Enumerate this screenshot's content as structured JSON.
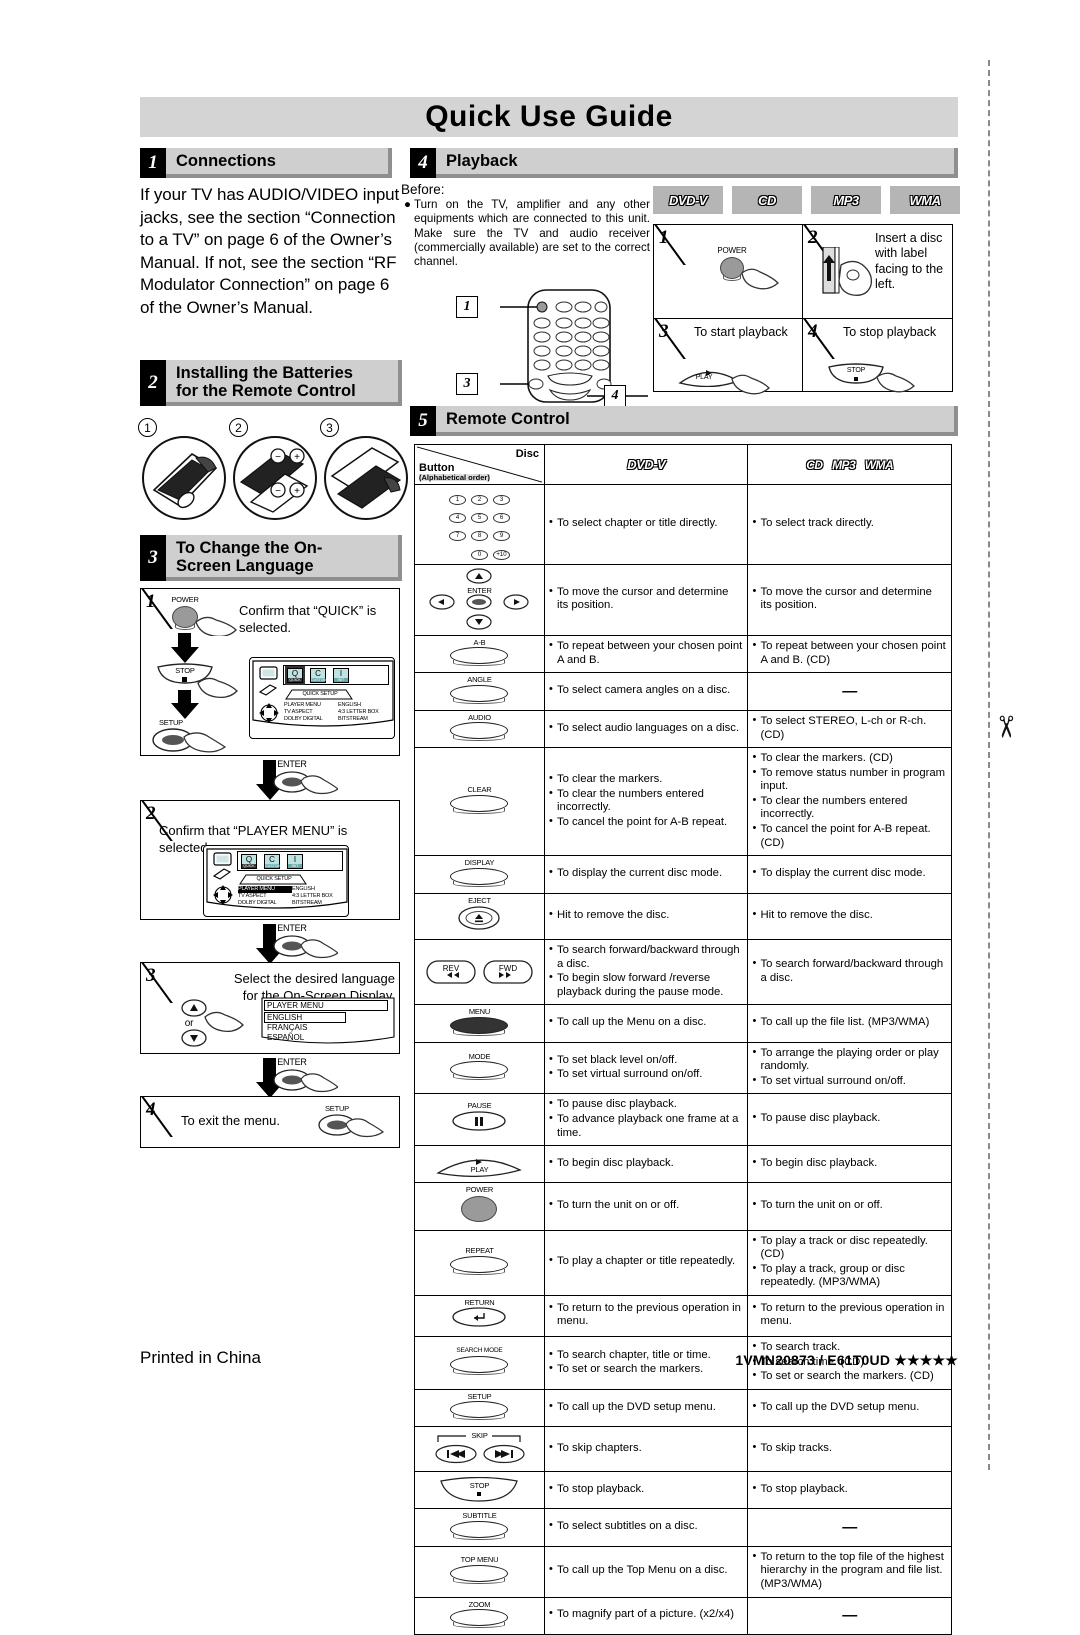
{
  "document": {
    "title": "Quick Use Guide",
    "footer_left": "Printed in China",
    "footer_right": "1VMN20873 / E61T0UD ★★★★★"
  },
  "sections": {
    "connections": {
      "number": "1",
      "title": "Connections",
      "body": "If your TV has AUDIO/VIDEO input jacks, see the section “Connection to a TV” on page 6 of the Owner’s Manual. If not, see the section “RF Modulator Connection” on page 6 of the Owner’s Manual."
    },
    "batteries": {
      "number": "2",
      "title_line1": "Installing the Batteries",
      "title_line2": "for the Remote Control",
      "figures": [
        "1",
        "2",
        "3"
      ],
      "polarity": [
        "−",
        "+",
        "−",
        "+"
      ]
    },
    "language": {
      "number": "3",
      "title_line1": "To Change the On-",
      "title_line2": "Screen Language",
      "steps": [
        {
          "n": "1",
          "text": "Confirm that “QUICK” is selected.",
          "buttons": [
            "POWER",
            "STOP",
            "SETUP"
          ],
          "osd": {
            "menu_label": "QUICK SETUP",
            "rows": [
              {
                "item": "PLAYER MENU",
                "value": "ENGLISH"
              },
              {
                "item": "TV ASPECT",
                "value": "4:3 LETTER BOX"
              },
              {
                "item": "DOLBY DIGITAL",
                "value": "BITSTREAM"
              }
            ]
          }
        },
        {
          "n": "2",
          "text": "Confirm that “PLAYER MENU” is selected.",
          "osd": {
            "menu_label": "QUICK SETUP",
            "rows": [
              {
                "item": "PLAYER MENU",
                "value": "ENGLISH"
              },
              {
                "item": "TV ASPECT",
                "value": "4:3 LETTER BOX"
              },
              {
                "item": "DOLBY DIGITAL",
                "value": "BITSTREAM"
              }
            ]
          }
        },
        {
          "n": "3",
          "text": "Select the desired language for the On-Screen Display.",
          "or_label": "or",
          "osd": {
            "title": "PLAYER MENU",
            "options": [
              "ENGLISH",
              "FRANÇAIS",
              "ESPAÑOL"
            ]
          }
        },
        {
          "n": "4",
          "text": "To exit the menu.",
          "buttons": [
            "SETUP"
          ]
        }
      ],
      "connector_label": "ENTER",
      "exit_button": "SETUP"
    },
    "playback": {
      "number": "4",
      "title": "Playback",
      "before_label": "Before:",
      "before_text": "Turn on the TV, amplifier and any other equipments which are connected to this unit. Make sure the TV and audio receiver (commercially available) are set to the correct channel.",
      "disc_chips": [
        "DVD-V",
        "CD",
        "MP3",
        "WMA"
      ],
      "remote_callouts": [
        "1",
        "3",
        "4"
      ],
      "steps": [
        {
          "n": "1",
          "text": "",
          "button": "POWER"
        },
        {
          "n": "2",
          "text": "Insert a disc with label facing to the left."
        },
        {
          "n": "3",
          "text": "To start playback",
          "button": "PLAY"
        },
        {
          "n": "4",
          "text": "To stop playback",
          "button": "STOP"
        }
      ]
    },
    "remote_control": {
      "number": "5",
      "title": "Remote Control",
      "table": {
        "header": {
          "col1_main": "Button",
          "col1_sub": "(Alphabetical order)",
          "col1_disc": "Disc",
          "col2": "DVD-V",
          "col3": [
            "CD",
            "MP3",
            "WMA"
          ]
        },
        "rows": [
          {
            "button": "NUMBER",
            "button_keys": [
              "1",
              "2",
              "3",
              "4",
              "5",
              "6",
              "7",
              "8",
              "9",
              "0",
              "+10"
            ],
            "dvd": [
              "To select chapter or title directly."
            ],
            "cd": [
              "To select track directly."
            ]
          },
          {
            "button": "CURSOR / ENTER",
            "button_label": "ENTER",
            "dvd": [
              "To move the cursor and determine its position."
            ],
            "cd": [
              "To move the cursor and determine its position."
            ]
          },
          {
            "button": "A-B",
            "dvd": [
              "To repeat between your chosen point A and B."
            ],
            "cd": [
              "To repeat between your chosen point A and B. (CD)"
            ]
          },
          {
            "button": "ANGLE",
            "dvd": [
              "To select camera angles on a disc."
            ],
            "cd": [
              "—"
            ]
          },
          {
            "button": "AUDIO",
            "dvd": [
              "To select audio languages on a disc."
            ],
            "cd": [
              "To select STEREO, L-ch or R-ch. (CD)"
            ]
          },
          {
            "button": "CLEAR",
            "dvd": [
              "To clear the markers.",
              "To clear the numbers entered incorrectly.",
              "To cancel the point for A-B repeat."
            ],
            "cd": [
              "To clear the markers. (CD)",
              "To remove status number in program input.",
              "To clear the numbers entered incorrectly.",
              "To cancel the point for A-B repeat. (CD)"
            ]
          },
          {
            "button": "DISPLAY",
            "dvd": [
              "To display the current disc mode."
            ],
            "cd": [
              "To display the current disc mode."
            ]
          },
          {
            "button": "EJECT",
            "dvd": [
              "Hit to remove the disc."
            ],
            "cd": [
              "Hit to remove the disc."
            ]
          },
          {
            "button": "REV / FWD",
            "dvd": [
              "To search forward/backward through a disc.",
              "To begin slow forward /reverse playback during the pause mode."
            ],
            "cd": [
              "To search forward/backward through a disc."
            ]
          },
          {
            "button": "MENU",
            "dvd": [
              "To call up the Menu on a disc."
            ],
            "cd": [
              "To call up the file list. (MP3/WMA)"
            ]
          },
          {
            "button": "MODE",
            "dvd": [
              "To set black level on/off.",
              "To set virtual surround on/off."
            ],
            "cd": [
              "To arrange the playing order or play randomly.",
              "To set virtual surround on/off."
            ]
          },
          {
            "button": "PAUSE",
            "dvd": [
              "To pause disc playback.",
              "To advance playback one frame at a time."
            ],
            "cd": [
              "To pause disc playback."
            ]
          },
          {
            "button": "PLAY",
            "dvd": [
              "To begin disc playback."
            ],
            "cd": [
              "To begin disc playback."
            ]
          },
          {
            "button": "POWER",
            "dvd": [
              "To turn the unit on or off."
            ],
            "cd": [
              "To turn the unit on or off."
            ]
          },
          {
            "button": "REPEAT",
            "dvd": [
              "To play a chapter or title repeatedly."
            ],
            "cd": [
              "To play a track or disc repeatedly. (CD)",
              "To play a track, group or disc repeatedly. (MP3/WMA)"
            ]
          },
          {
            "button": "RETURN",
            "dvd": [
              "To return to the previous operation in menu."
            ],
            "cd": [
              "To return to the previous operation in menu."
            ]
          },
          {
            "button": "SEARCH MODE",
            "dvd": [
              "To search chapter, title or time.",
              "To set or search the markers."
            ],
            "cd": [
              "To search track.",
              "To search time. (CD)",
              "To set or search the markers. (CD)"
            ]
          },
          {
            "button": "SETUP",
            "dvd": [
              "To call up the DVD setup menu."
            ],
            "cd": [
              "To call up the DVD setup menu."
            ]
          },
          {
            "button": "SKIP",
            "dvd": [
              "To skip chapters."
            ],
            "cd": [
              "To skip tracks."
            ]
          },
          {
            "button": "STOP",
            "dvd": [
              "To stop playback."
            ],
            "cd": [
              "To stop playback."
            ]
          },
          {
            "button": "SUBTITLE",
            "dvd": [
              "To select subtitles on a disc."
            ],
            "cd": [
              "—"
            ]
          },
          {
            "button": "TOP MENU",
            "dvd": [
              "To call up the Top Menu on a disc."
            ],
            "cd": [
              "To return to the top file of the highest hierarchy in the program and file list. (MP3/WMA)"
            ]
          },
          {
            "button": "ZOOM",
            "dvd": [
              "To magnify part of a picture. (x2/x4)"
            ],
            "cd": [
              "—"
            ]
          }
        ]
      }
    }
  },
  "colors": {
    "header_bg": "#d4d4d4",
    "section_bar": "#cfcfcf",
    "section_shadow": "#8f8f8f",
    "chip_bg": "#b5b5b5",
    "power_btn": "#9a9a9a"
  }
}
